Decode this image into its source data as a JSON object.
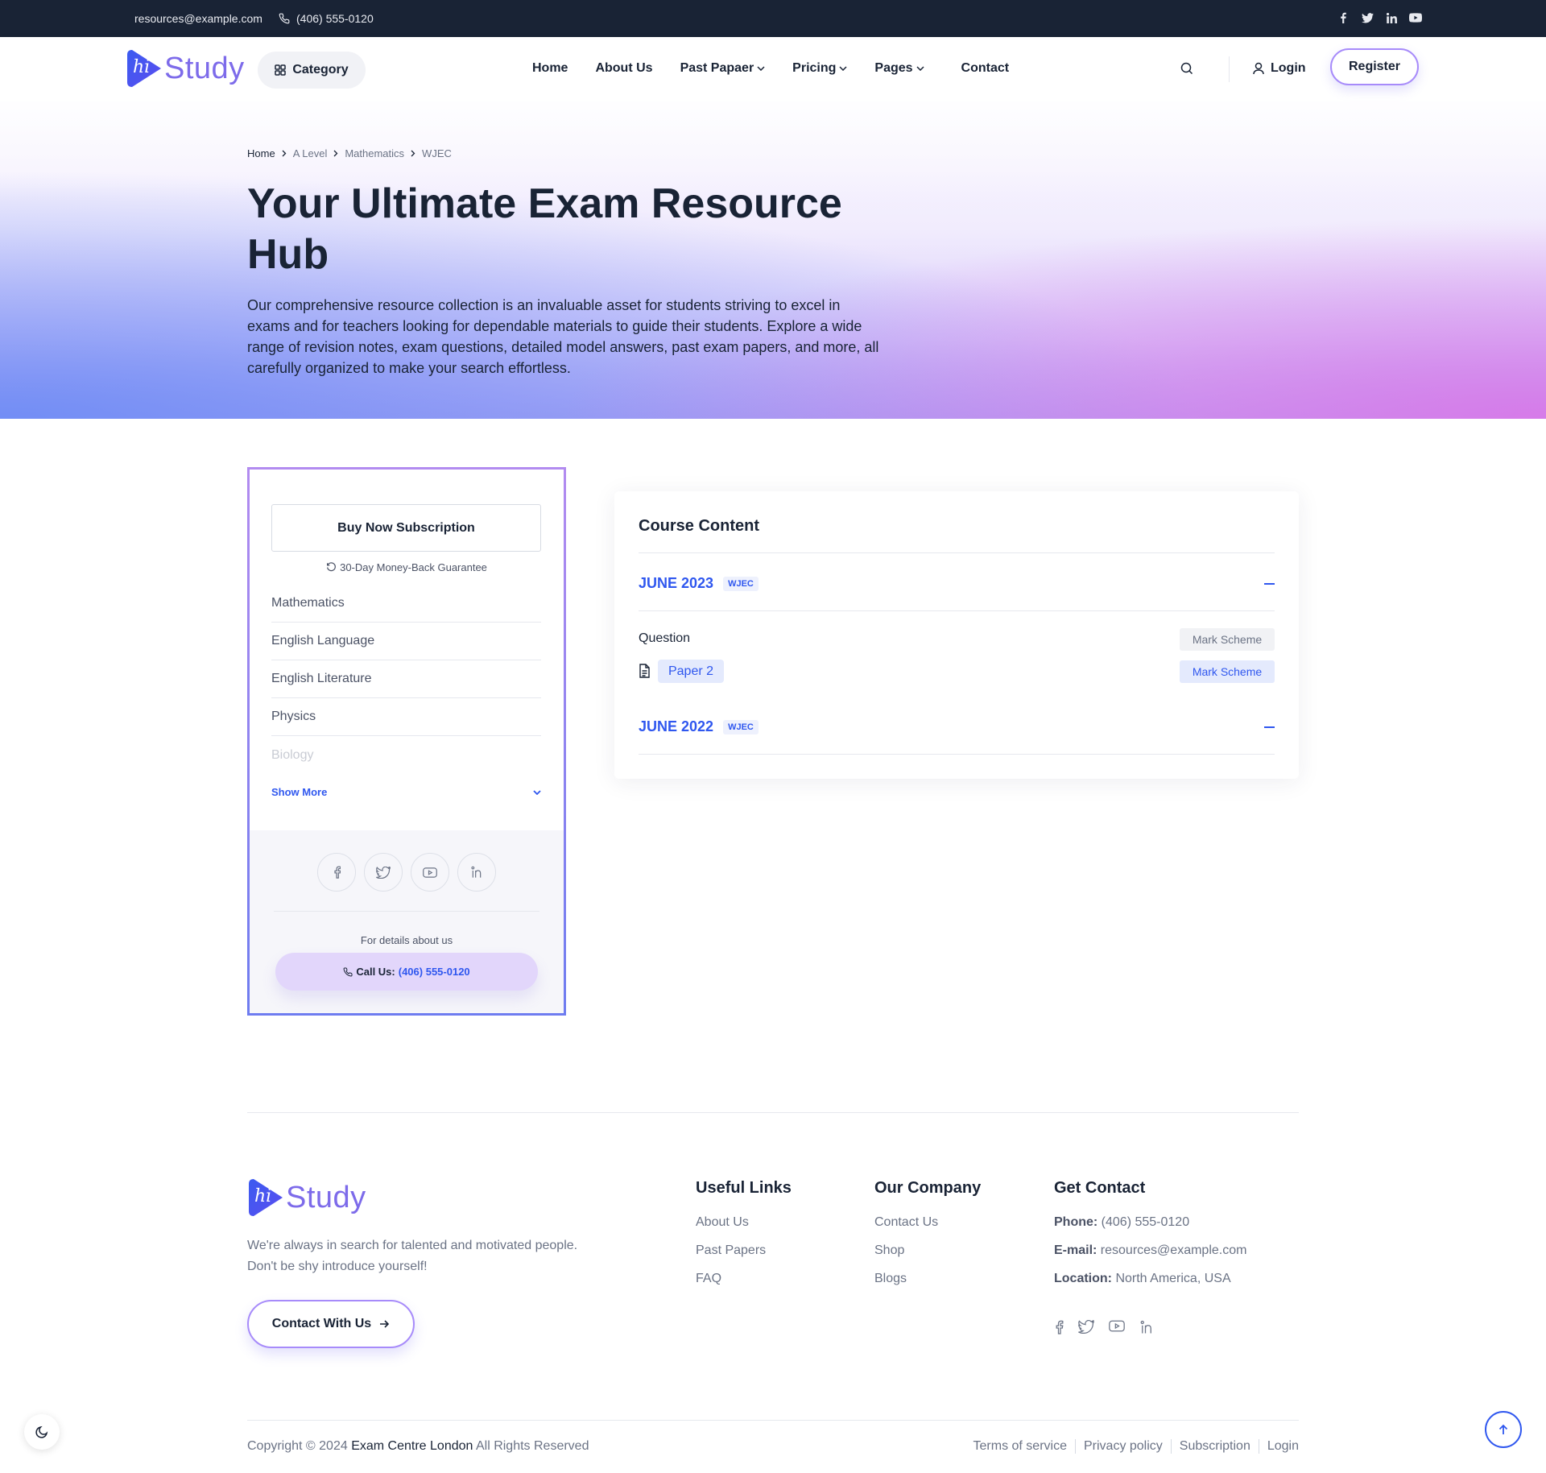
{
  "topbar": {
    "email": "resources@example.com",
    "phone": "(406) 555-0120",
    "social_icons": [
      "facebook-icon",
      "twitter-icon",
      "linkedin-icon",
      "youtube-icon"
    ]
  },
  "header": {
    "logo_text": "Study",
    "logo_badge": "hi",
    "category_label": "Category",
    "nav": [
      {
        "label": "Home",
        "dropdown": false
      },
      {
        "label": "About Us",
        "dropdown": false
      },
      {
        "label": "Past Papaer",
        "dropdown": true
      },
      {
        "label": "Pricing",
        "dropdown": true
      },
      {
        "label": "Pages",
        "dropdown": true
      },
      {
        "label": "Contact",
        "dropdown": false
      }
    ],
    "login_label": "Login",
    "register_label": "Register"
  },
  "hero": {
    "breadcrumb": [
      "Home",
      "A Level",
      "Mathematics",
      "WJEC"
    ],
    "title": "Your Ultimate Exam Resource Hub",
    "description": "Our comprehensive resource collection is an invaluable asset for students striving to excel in exams and for teachers looking for dependable materials to guide their students. Explore a wide range of revision notes, exam questions, detailed model answers, past exam papers, and more, all carefully organized to make your search effortless."
  },
  "sidebar": {
    "buy_label": "Buy Now Subscription",
    "guarantee": "30-Day Money-Back Guarantee",
    "subjects": [
      "Mathematics",
      "English Language",
      "English Literature",
      "Physics",
      "Biology"
    ],
    "show_more": "Show More",
    "details_text": "For details about us",
    "call_label": "Call Us:",
    "call_number": "(406) 555-0120"
  },
  "course": {
    "title": "Course Content",
    "sections": [
      {
        "year": "JUNE 2023",
        "board": "WJEC",
        "expanded": true
      },
      {
        "year": "JUNE 2022",
        "board": "WJEC",
        "expanded": true
      }
    ],
    "question_label": "Question",
    "mark_scheme_header": "Mark Scheme",
    "paper_label": "Paper 2",
    "mark_scheme_link": "Mark Scheme"
  },
  "footer": {
    "about": "We're always in search for talented and motivated people. Don't be shy introduce yourself!",
    "contact_button": "Contact With Us",
    "useful_links": {
      "title": "Useful Links",
      "items": [
        "About Us",
        "Past Papers",
        "FAQ"
      ]
    },
    "company": {
      "title": "Our Company",
      "items": [
        "Contact Us",
        "Shop",
        "Blogs"
      ]
    },
    "get_contact": {
      "title": "Get Contact",
      "phone_label": "Phone:",
      "phone": "(406) 555-0120",
      "email_label": "E-mail:",
      "email": "resources@example.com",
      "location_label": "Location:",
      "location": "North America, USA"
    },
    "copyright_prefix": "Copyright © 2024",
    "copyright_org": "Exam Centre London",
    "copyright_suffix": "All Rights Reserved",
    "bottom_links": [
      "Terms of service",
      "Privacy policy",
      "Subscription",
      "Login"
    ]
  },
  "colors": {
    "accent": "#2f57ef",
    "purple": "#a78bfa",
    "dark": "#192335"
  }
}
